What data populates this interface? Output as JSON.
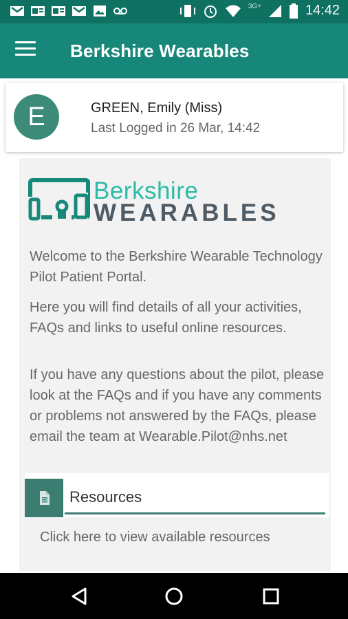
{
  "status_bar": {
    "time": "14:42",
    "network": "3G+",
    "icons": [
      "gmail-icon",
      "outlook-icon",
      "outlook-icon",
      "gmail-icon",
      "gallery-icon",
      "voicemail-icon",
      "vibrate-icon",
      "alarm-icon",
      "wifi-icon",
      "signal-icon",
      "battery-icon"
    ]
  },
  "app_bar": {
    "title": "Berkshire Wearables",
    "menu_icon": "hamburger-menu-icon"
  },
  "profile": {
    "avatar_letter": "E",
    "name": "GREEN, Emily (Miss)",
    "last_login": "Last Logged in 26 Mar, 14:42"
  },
  "logo": {
    "line1": "Berkshire",
    "line2": "WEARABLES"
  },
  "welcome": {
    "p1": "Welcome to the Berkshire Wearable Technology Pilot Patient Portal.",
    "p2": "Here you will find details of all your activities, FAQs and links to useful online resources.",
    "p3": "If you have any questions about the pilot, please look at the FAQs and if you have any comments or problems not answered by the FAQs,  please email the team at Wearable.Pilot@nhs.net"
  },
  "resources": {
    "title": "Resources",
    "link": "Click here to view available resources",
    "icon": "document-icon"
  },
  "nav_bar": {
    "buttons": [
      "back-triangle-icon",
      "home-circle-icon",
      "recents-square-icon"
    ]
  },
  "colors": {
    "status_bar": "#0e7161",
    "app_bar": "#17877a",
    "accent": "#3c7d72",
    "logo_teal": "#2cbba6",
    "logo_gray": "#4e5a64"
  }
}
